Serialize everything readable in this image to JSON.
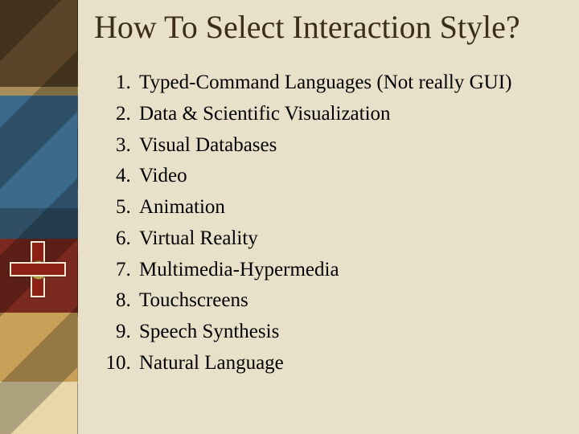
{
  "title": "How To Select Interaction Style?",
  "items": [
    "Typed-Command Languages (Not really GUI)",
    "Data & Scientific Visualization",
    "Visual Databases",
    "Video",
    "Animation",
    "Virtual Reality",
    "Multimedia-Hypermedia",
    "Touchscreens",
    "Speech Synthesis",
    "Natural Language"
  ]
}
